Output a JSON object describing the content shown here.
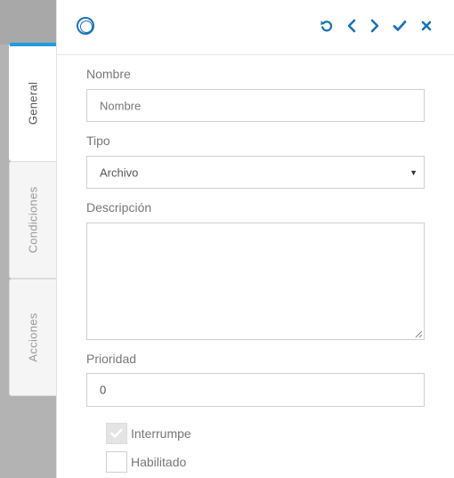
{
  "tabs": [
    {
      "label": "General",
      "active": true
    },
    {
      "label": "Condiciones",
      "active": false
    },
    {
      "label": "Acciones",
      "active": false
    }
  ],
  "header": {
    "icons": [
      "ring-icon",
      "undo-icon",
      "chevron-left-icon",
      "chevron-right-icon",
      "check-icon",
      "close-icon"
    ]
  },
  "form": {
    "nombre": {
      "label": "Nombre",
      "placeholder": "Nombre",
      "value": ""
    },
    "tipo": {
      "label": "Tipo",
      "selected": "Archivo"
    },
    "descripcion": {
      "label": "Descripción",
      "value": ""
    },
    "prioridad": {
      "label": "Prioridad",
      "value": "0"
    },
    "interrumpe": {
      "label": "Interrumpe",
      "checked": true
    },
    "habilitado": {
      "label": "Habilitado",
      "checked": false
    }
  },
  "colors": {
    "accent": "#1e9ce0",
    "icon": "#1a73b5",
    "backdrop": "#b3b3b3"
  }
}
